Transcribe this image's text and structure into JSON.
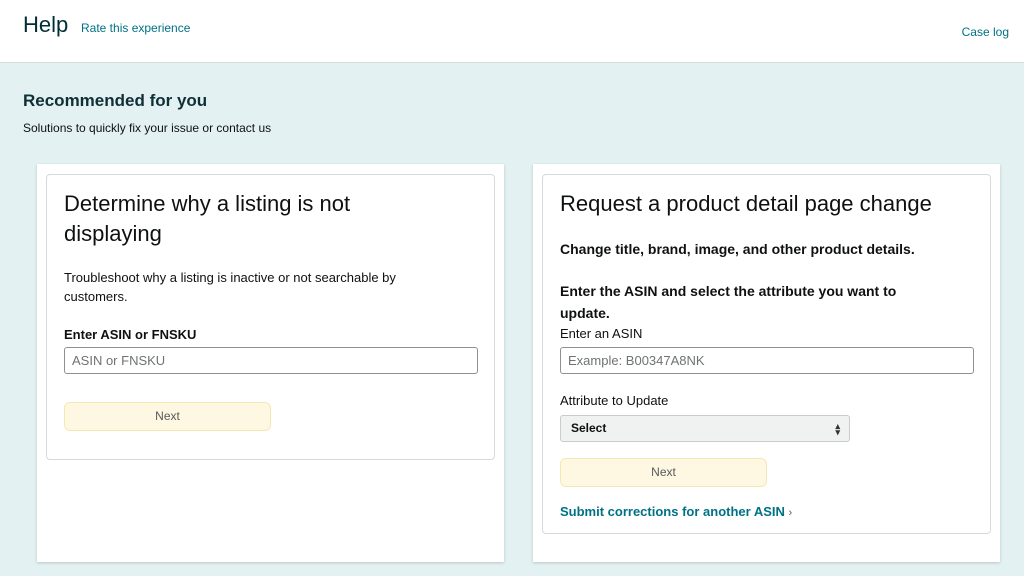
{
  "header": {
    "title": "Help",
    "rate_link": "Rate this experience",
    "case_log": "Case log"
  },
  "recommended": {
    "title": "Recommended for you",
    "subtitle": "Solutions to quickly fix your issue or contact us"
  },
  "card1": {
    "heading_line1": "Determine why a listing is not",
    "heading_line2": "displaying",
    "desc_line1": "Troubleshoot why a listing is inactive or not searchable by",
    "desc_line2": "customers.",
    "input_label": "Enter ASIN or FNSKU",
    "input_placeholder": "ASIN or FNSKU",
    "input_value": "",
    "next_label": "Next"
  },
  "card2": {
    "heading": "Request a product detail page change",
    "subheading": "Change title, brand, image, and other product details.",
    "instruction_line1": "Enter the ASIN and select the attribute you want to",
    "instruction_line2": "update.",
    "asin_label": "Enter an ASIN",
    "asin_placeholder": "Example: B00347A8NK",
    "asin_value": "",
    "attribute_label": "Attribute to Update",
    "attribute_selected": "Select",
    "next_label": "Next",
    "submit_link": "Submit corrections for another ASIN",
    "submit_chevron": "›"
  },
  "icons": {
    "select_arrows": "up-down-arrows-icon",
    "link_chevron": "chevron-right-icon"
  },
  "colors": {
    "background": "#e3f1f2",
    "link": "#007185",
    "button_bg": "#fef8e2",
    "heading": "#0f2f36"
  }
}
